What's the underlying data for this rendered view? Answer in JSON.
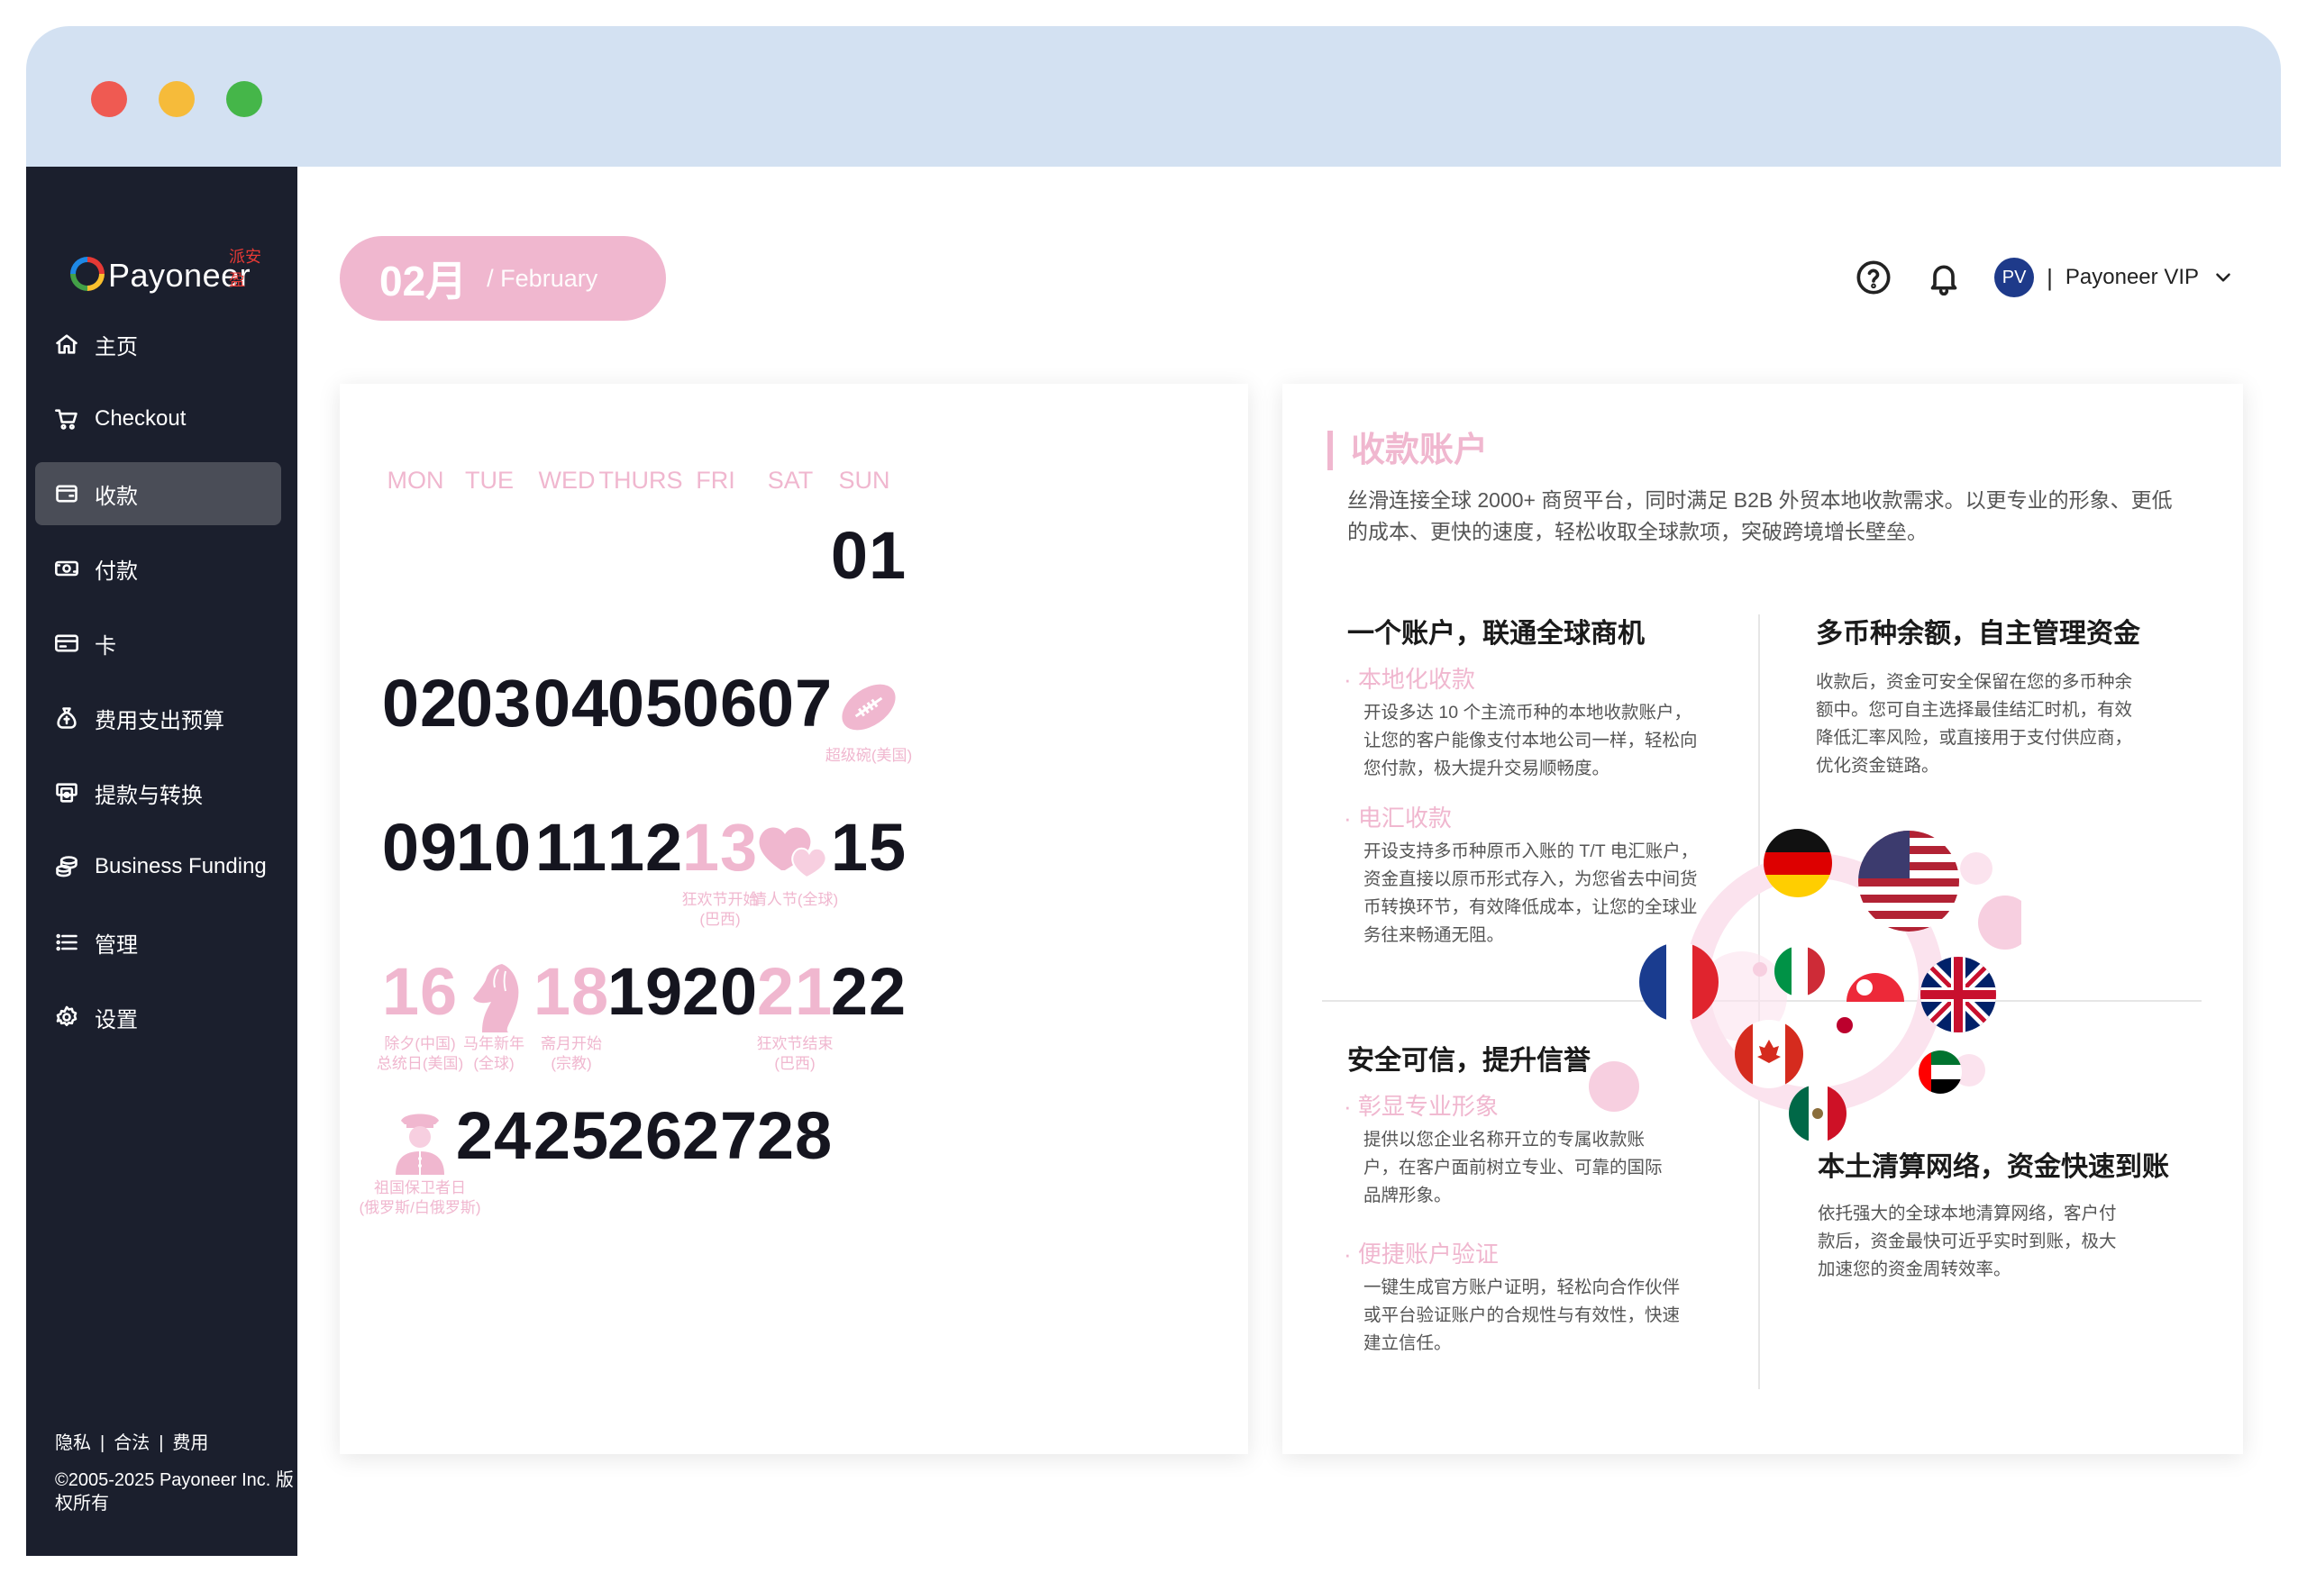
{
  "window": {
    "buttons": [
      "close",
      "minimize",
      "maximize"
    ]
  },
  "sidebar": {
    "logo": {
      "text": "Payoneer",
      "tagline": "派安盈"
    },
    "items": [
      {
        "label": "主页",
        "icon": "home-icon"
      },
      {
        "label": "Checkout",
        "icon": "cart-icon"
      },
      {
        "label": "收款",
        "icon": "wallet-icon",
        "active": true
      },
      {
        "label": "付款",
        "icon": "payment-icon"
      },
      {
        "label": "卡",
        "icon": "card-icon"
      },
      {
        "label": "费用支出预算",
        "icon": "budget-icon"
      },
      {
        "label": "提款与转换",
        "icon": "withdraw-icon"
      },
      {
        "label": "Business Funding",
        "icon": "funding-icon"
      },
      {
        "label": "管理",
        "icon": "list-icon"
      },
      {
        "label": "设置",
        "icon": "gear-icon"
      }
    ],
    "footer": {
      "links": [
        "隐私",
        "合法",
        "费用"
      ],
      "separator": "|",
      "copyright": "©2005-2025 Payoneer Inc. 版权所有"
    }
  },
  "header": {
    "month": "02月",
    "month_en": "/ February",
    "user": {
      "initials": "PV",
      "separator": "|",
      "name": "Payoneer VIP"
    }
  },
  "calendar": {
    "weekdays": [
      "MON",
      "TUE",
      "WED",
      "THURS",
      "FRI",
      "SAT",
      "SUN"
    ],
    "cells": [
      {
        "day": "01",
        "col": 6,
        "row": 0,
        "pink": false
      },
      {
        "day": "02",
        "col": 0,
        "row": 1,
        "pink": false
      },
      {
        "day": "03",
        "col": 1,
        "row": 1,
        "pink": false
      },
      {
        "day": "04",
        "col": 2,
        "row": 1,
        "pink": false
      },
      {
        "day": "05",
        "col": 3,
        "row": 1,
        "pink": false
      },
      {
        "day": "06",
        "col": 4,
        "row": 1,
        "pink": false
      },
      {
        "day": "07",
        "col": 5,
        "row": 1,
        "pink": false
      },
      {
        "day": "",
        "col": 6,
        "row": 1,
        "icon": "football-icon",
        "note": "超级碗(美国)"
      },
      {
        "day": "09",
        "col": 0,
        "row": 2,
        "pink": false
      },
      {
        "day": "10",
        "col": 1,
        "row": 2,
        "pink": false
      },
      {
        "day": "11",
        "col": 2,
        "row": 2,
        "pink": false
      },
      {
        "day": "12",
        "col": 3,
        "row": 2,
        "pink": false
      },
      {
        "day": "13",
        "col": 4,
        "row": 2,
        "pink": true,
        "note": "狂欢节开始\n(巴西)"
      },
      {
        "day": "",
        "col": 5,
        "row": 2,
        "icon": "hearts-icon",
        "note": "情人节(全球)"
      },
      {
        "day": "15",
        "col": 6,
        "row": 2,
        "pink": false
      },
      {
        "day": "16",
        "col": 0,
        "row": 3,
        "pink": true,
        "note": "除夕(中国)\n总统日(美国)"
      },
      {
        "day": "",
        "col": 1,
        "row": 3,
        "icon": "horse-icon",
        "note": "马年新年\n(全球)"
      },
      {
        "day": "18",
        "col": 2,
        "row": 3,
        "pink": true,
        "note": "斋月开始\n(宗教)"
      },
      {
        "day": "19",
        "col": 3,
        "row": 3,
        "pink": false
      },
      {
        "day": "20",
        "col": 4,
        "row": 3,
        "pink": false
      },
      {
        "day": "21",
        "col": 5,
        "row": 3,
        "pink": true,
        "note": "狂欢节结束\n(巴西)"
      },
      {
        "day": "22",
        "col": 6,
        "row": 3,
        "pink": false
      },
      {
        "day": "",
        "col": 0,
        "row": 4,
        "icon": "soldier-icon",
        "note": "祖国保卫者日\n(俄罗斯/白俄罗斯)"
      },
      {
        "day": "24",
        "col": 1,
        "row": 4,
        "pink": false
      },
      {
        "day": "25",
        "col": 2,
        "row": 4,
        "pink": false
      },
      {
        "day": "26",
        "col": 3,
        "row": 4,
        "pink": false
      },
      {
        "day": "27",
        "col": 4,
        "row": 4,
        "pink": false
      },
      {
        "day": "28",
        "col": 5,
        "row": 4,
        "pink": false
      }
    ]
  },
  "info": {
    "title": "收款账户",
    "description": "丝滑连接全球 2000+ 商贸平台，同时满足 B2B 外贸本地收款需求。以更专业的形象、更低的成本、更快的速度，轻松收取全球款项，突破跨境增长壁垒。",
    "sections": [
      {
        "heading": "一个账户，联通全球商机",
        "items": [
          {
            "subheading": "本地化收款",
            "text": "开设多达 10 个主流币种的本地收款账户，让您的客户能像支付本地公司一样，轻松向您付款，极大提升交易顺畅度。"
          },
          {
            "subheading": "电汇收款",
            "text": "开设支持多币种原币入账的 T/T 电汇账户，资金直接以原币形式存入，为您省去中间货币转换环节，有效降低成本，让您的全球业务往来畅通无阻。"
          }
        ]
      },
      {
        "heading": "多币种余额，自主管理资金",
        "items": [
          {
            "subheading": "",
            "text": "收款后，资金可安全保留在您的多币种余额中。您可自主选择最佳结汇时机，有效降低汇率风险，或直接用于支付供应商，优化资金链路。"
          }
        ]
      },
      {
        "heading": "安全可信，提升信誉",
        "items": [
          {
            "subheading": "彰显专业形象",
            "text": "提供以您企业名称开立的专属收款账户，在客户面前树立专业、可靠的国际品牌形象。"
          },
          {
            "subheading": "便捷账户验证",
            "text": "一键生成官方账户证明，轻松向合作伙伴或平台验证账户的合规性与有效性，快速建立信任。"
          }
        ]
      },
      {
        "heading": "本土清算网络，资金快速到账",
        "items": [
          {
            "subheading": "",
            "text": "依托强大的全球本地清算网络，客户付款后，资金最快可近乎实时到账，极大加速您的资金周转效率。"
          }
        ]
      }
    ]
  },
  "colors": {
    "pink": "#f0b7cf",
    "sidebar": "#1b1f2d",
    "titlebar": "#d3e1f2",
    "active": "#4a4d57"
  }
}
